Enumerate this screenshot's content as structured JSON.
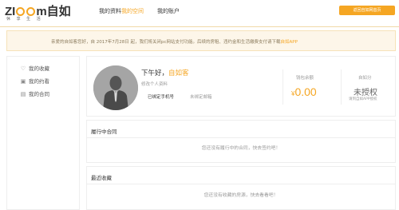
{
  "header": {
    "logo_text_pre": "ZI",
    "logo_text_post": "m自如",
    "logo_sub": "休 享 生 活",
    "nav": [
      {
        "label": "我的资料",
        "active": false
      },
      {
        "label": "我的空间",
        "active": true
      },
      {
        "label": "我的账户",
        "active": false
      }
    ],
    "home_button": "返回自如网首页"
  },
  "notice": {
    "text": "亲爱的自如客您好，自 2017年7月28日 起，我们将关闭pc网站支付功能。后续的房租、违约金和生活缴费支付请下载",
    "link": "自如APP"
  },
  "sidebar": {
    "items": [
      {
        "label": "我的收藏",
        "icon": "heart-icon",
        "glyph": "♡"
      },
      {
        "label": "我的约看",
        "icon": "calendar-icon",
        "glyph": "▣"
      },
      {
        "label": "我的合同",
        "icon": "document-icon",
        "glyph": "▤"
      }
    ]
  },
  "profile": {
    "greeting": "下午好，",
    "username": "自如客",
    "edit_link": "修改个人资料",
    "phone_bound": "已绑定手机号",
    "email_unbound": "未绑定邮箱",
    "wallet_label": "钱包余额",
    "wallet_currency": "¥",
    "wallet_amount": "0.00",
    "credit_label": "自如分",
    "credit_value": "未授权",
    "credit_sub": "请到自如APP授权"
  },
  "contracts": {
    "title": "履行中合同",
    "empty": "您还没有履行中的合同，快去签约吧！"
  },
  "favorites": {
    "title": "最近收藏",
    "empty": "您还没有收藏的房源，快去看看吧！"
  },
  "colors": {
    "accent": "#f5a623",
    "notice_bg": "#fdf6e9",
    "avatar_bg": "#a5a5a5"
  }
}
